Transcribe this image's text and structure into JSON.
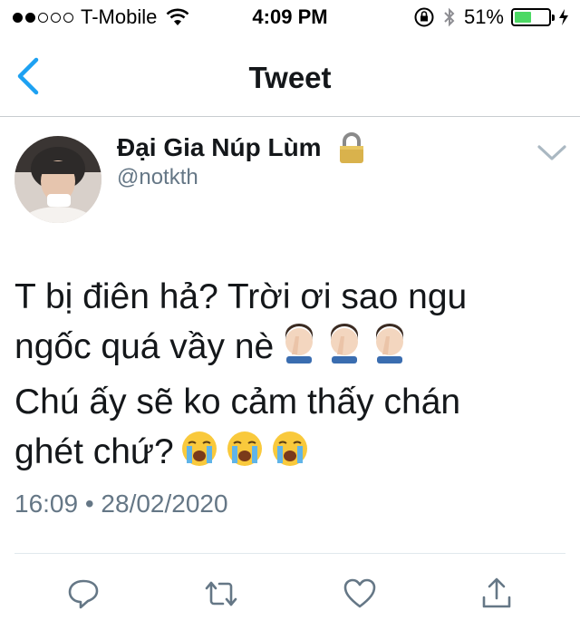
{
  "status_bar": {
    "carrier": "T-Mobile",
    "time": "4:09 PM",
    "battery": "51%",
    "battery_level": 0.51,
    "signal_filled": 2,
    "signal_total": 5
  },
  "nav": {
    "title": "Tweet",
    "back_icon": "chevron-left-icon",
    "accent_color": "#1da1f2"
  },
  "tweet": {
    "display_name": "Đại Gia Núp Lùm",
    "handle": "@notkth",
    "text_line1": "T bị điên hả? Trời ơi sao ngu",
    "text_line2": "ngốc quá vầy nè",
    "text_line3": "Chú ấy sẽ ko cảm thấy chán",
    "text_line4": "ghét chứ?",
    "emoji_line2": [
      "face-palm-emoji",
      "face-palm-emoji",
      "face-palm-emoji"
    ],
    "emoji_line4": [
      "crying-face-emoji",
      "crying-face-emoji",
      "crying-face-emoji"
    ],
    "timestamp": "16:09 • 28/02/2020"
  },
  "actions": [
    "reply-icon",
    "retweet-icon",
    "like-icon",
    "share-icon"
  ]
}
